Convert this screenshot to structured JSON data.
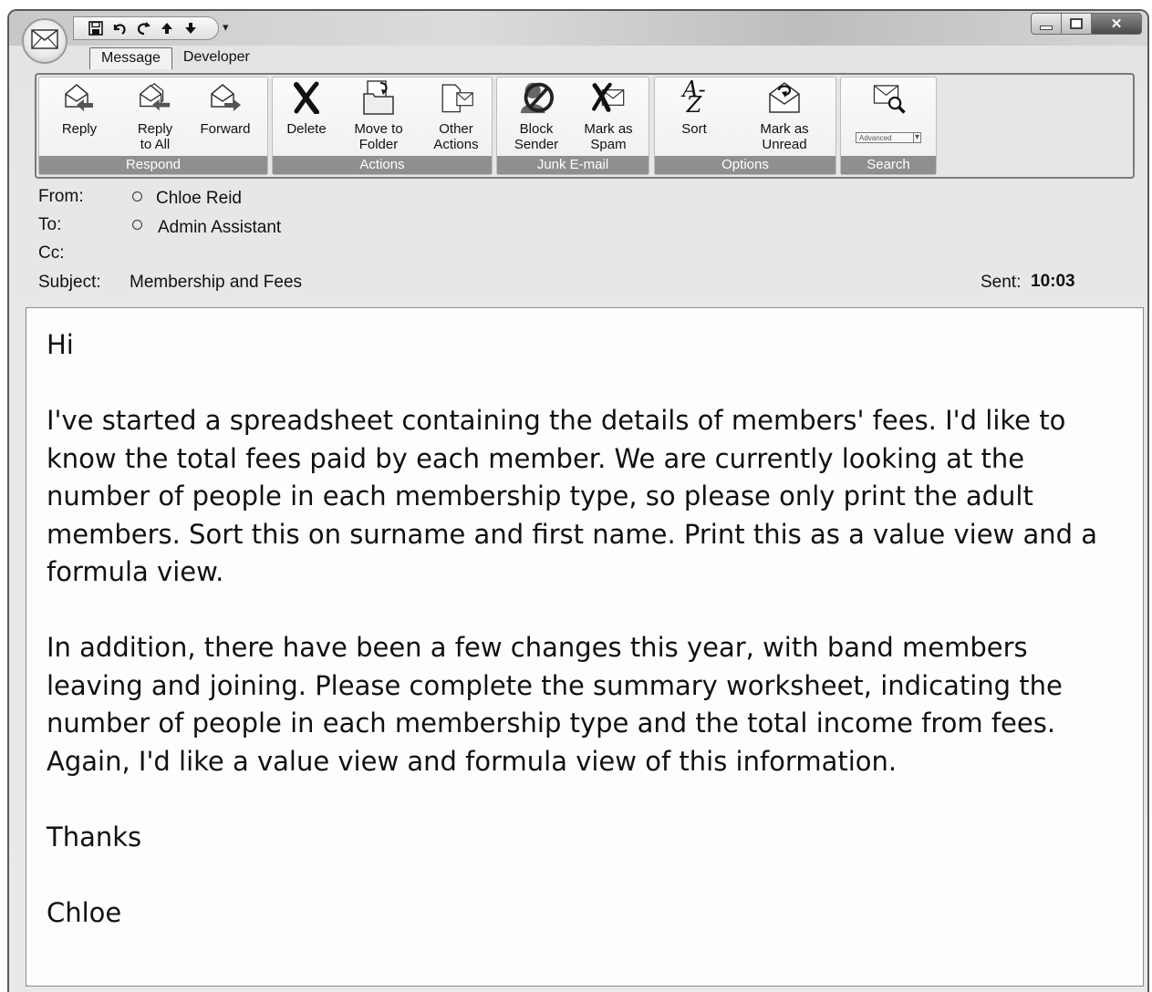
{
  "quick_access": {
    "icons": [
      "save-icon",
      "undo-icon",
      "redo-icon",
      "up-arrow-icon",
      "down-arrow-icon"
    ],
    "dropdown": "▾"
  },
  "window_controls": {
    "close": "✕"
  },
  "tabs": [
    {
      "label": "Message",
      "active": true
    },
    {
      "label": "Developer",
      "active": false
    }
  ],
  "ribbon": {
    "groups": {
      "respond": {
        "label": "Respond",
        "buttons": {
          "reply": "Reply",
          "reply_all": "Reply\nto All",
          "forward": "Forward"
        }
      },
      "actions": {
        "label": "Actions",
        "buttons": {
          "delete": "Delete",
          "move_to_folder": "Move to\nFolder",
          "other_actions": "Other\nActions"
        }
      },
      "junk": {
        "label": "Junk E-mail",
        "buttons": {
          "block_sender": "Block\nSender",
          "mark_as_spam": "Mark as\nSpam"
        }
      },
      "options": {
        "label": "Options",
        "buttons": {
          "sort": "Sort",
          "sort_icon_text": "A-Z",
          "mark_as_unread": "Mark as\nUnread"
        }
      },
      "search": {
        "label": "Search",
        "advanced": "Advanced"
      }
    }
  },
  "header": {
    "from_label": "From:",
    "from_value": "Chloe Reid",
    "to_label": "To:",
    "to_value": "Admin Assistant",
    "cc_label": "Cc:",
    "cc_value": "",
    "subject_label": "Subject:",
    "subject_value": "Membership and Fees",
    "sent_label": "Sent:",
    "sent_value": "10:03"
  },
  "message": {
    "greeting": "Hi",
    "paragraph1": "I've started a spreadsheet containing the details of members' fees. I'd like to know the total fees paid by each member. We are currently looking at the number of people in each membership type, so please only print the adult members. Sort this on surname and first name. Print this as a value view and a formula view.",
    "paragraph2": "In addition, there have been a few changes this year, with band members leaving and joining. Please complete the summary worksheet, indicating the number of people in each membership type and the total income from fees. Again, I'd like a value view and formula view of this information.",
    "closing": "Thanks",
    "signature": "Chloe"
  }
}
